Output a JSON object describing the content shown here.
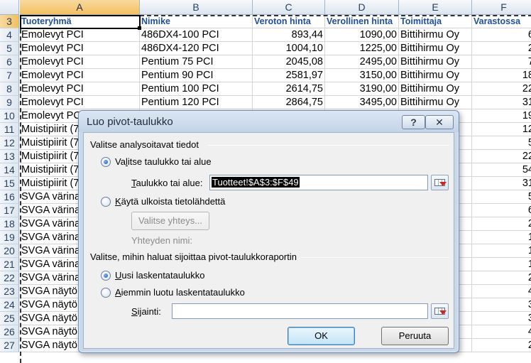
{
  "columns": [
    "A",
    "B",
    "C",
    "D",
    "E",
    "F"
  ],
  "header_row": {
    "row_number": "3",
    "cells": [
      "Tuoteryhmä",
      "Nimike",
      "Veroton hinta",
      "Verollinen hinta",
      "Toimittaja",
      "Varastossa"
    ]
  },
  "rows": [
    {
      "n": "4",
      "a": "Emolevyt PCI",
      "b": "486DX4-100 PCI",
      "c": "893,44",
      "d": "1090,00",
      "e": "Bittihirmu Oy",
      "f": "6"
    },
    {
      "n": "5",
      "a": "Emolevyt PCI",
      "b": "486DX4-120 PCI",
      "c": "1004,10",
      "d": "1225,00",
      "e": "Bittihirmu Oy",
      "f": "2"
    },
    {
      "n": "6",
      "a": "Emolevyt PCI",
      "b": "Pentium 75 PCI",
      "c": "2045,08",
      "d": "2495,00",
      "e": "Bittihirmu Oy",
      "f": "7"
    },
    {
      "n": "7",
      "a": "Emolevyt PCI",
      "b": "Pentium 90 PCI",
      "c": "2581,97",
      "d": "3150,00",
      "e": "Bittihirmu Oy",
      "f": "18"
    },
    {
      "n": "8",
      "a": "Emolevyt PCI",
      "b": "Pentium 100 PCI",
      "c": "2614,75",
      "d": "3190,00",
      "e": "Bittihirmu Oy",
      "f": "22"
    },
    {
      "n": "9",
      "a": "Emolevyt PCI",
      "b": "Pentium 120 PCI",
      "c": "2864,75",
      "d": "3495,00",
      "e": "Bittihirmu Oy",
      "f": "31"
    },
    {
      "n": "10",
      "a": "Emolevyt PCI",
      "b": "",
      "c": "",
      "d": "",
      "e": "",
      "f": "19"
    },
    {
      "n": "11",
      "a": "Muistipiirit (7",
      "b": "",
      "c": "",
      "d": "",
      "e": "",
      "f": "12"
    },
    {
      "n": "12",
      "a": "Muistipiirit (7",
      "b": "",
      "c": "",
      "d": "",
      "e": "",
      "f": "5"
    },
    {
      "n": "13",
      "a": "Muistipiirit (7",
      "b": "",
      "c": "",
      "d": "",
      "e": "",
      "f": "22"
    },
    {
      "n": "14",
      "a": "Muistipiirit (7",
      "b": "",
      "c": "",
      "d": "",
      "e": "",
      "f": "54"
    },
    {
      "n": "15",
      "a": "Muistipiirit (7",
      "b": "",
      "c": "",
      "d": "",
      "e": "",
      "f": "31"
    },
    {
      "n": "16",
      "a": "SVGA värina",
      "b": "",
      "c": "",
      "d": "",
      "e": "y",
      "f": "5"
    },
    {
      "n": "17",
      "a": "SVGA värina",
      "b": "",
      "c": "",
      "d": "",
      "e": "upp",
      "f": "6"
    },
    {
      "n": "18",
      "a": "SVGA värina",
      "b": "",
      "c": "",
      "d": "",
      "e": "y",
      "f": "2"
    },
    {
      "n": "19",
      "a": "SVGA värina",
      "b": "",
      "c": "",
      "d": "",
      "e": "upp",
      "f": "1"
    },
    {
      "n": "20",
      "a": "SVGA värina",
      "b": "",
      "c": "",
      "d": "",
      "e": "",
      "f": "1"
    },
    {
      "n": "21",
      "a": "SVGA värina",
      "b": "",
      "c": "",
      "d": "",
      "e": "upp",
      "f": "1"
    },
    {
      "n": "22",
      "a": "SVGA värina",
      "b": "",
      "c": "",
      "d": "",
      "e": "upp",
      "f": "2"
    },
    {
      "n": "23",
      "a": "SVGA näytö",
      "b": "",
      "c": "",
      "d": "",
      "e": "y",
      "f": "4"
    },
    {
      "n": "24",
      "a": "SVGA näytö",
      "b": "",
      "c": "",
      "d": "",
      "e": "",
      "f": "3"
    },
    {
      "n": "25",
      "a": "SVGA näytö",
      "b": "",
      "c": "",
      "d": "",
      "e": "",
      "f": "3"
    },
    {
      "n": "26",
      "a": "SVGA näytö",
      "b": "",
      "c": "",
      "d": "",
      "e": "",
      "f": "4"
    },
    {
      "n": "27",
      "a": "SVGA näytö",
      "b": "",
      "c": "",
      "d": "",
      "e": "",
      "f": "2"
    }
  ],
  "dialog": {
    "title": "Luo pivot-taulukko",
    "help_label": "?",
    "close_label": "✕",
    "section1_title": "Valitse analysoitavat tiedot",
    "opt_table": {
      "pre": "Va",
      "u": "l",
      "post": "itse taulukko tai alue",
      "selected": true
    },
    "table_label": {
      "pre": "",
      "u": "T",
      "post": "aulukko tai alue:"
    },
    "table_value": "Tuotteet!$A$3:$F$49",
    "opt_external": {
      "pre": "",
      "u": "K",
      "post": "äytä ulkoista tietolähdettä",
      "selected": false
    },
    "choose_connection_label": "Valitse yhteys...",
    "connection_name_label": "Yhteyden nimi:",
    "section2_title": "Valitse, mihin haluat sijoittaa pivot-taulukkoraportin",
    "opt_new_sheet": {
      "pre": "",
      "u": "U",
      "post": "usi laskentataulukko",
      "selected": true
    },
    "opt_existing": {
      "pre": "",
      "u": "A",
      "post": "iemmin luotu laskentataulukko",
      "selected": false
    },
    "location_label": {
      "pre": "",
      "u": "S",
      "post": "ijainti:"
    },
    "location_value": "",
    "ok_label": "OK",
    "cancel_label": "Peruuta"
  },
  "colors": {
    "header_text": "#1f4e9a",
    "selected_header": "#f1c15f",
    "dialog_frame": "#c9d8ea",
    "radio_dot": "#1d4fa8"
  }
}
